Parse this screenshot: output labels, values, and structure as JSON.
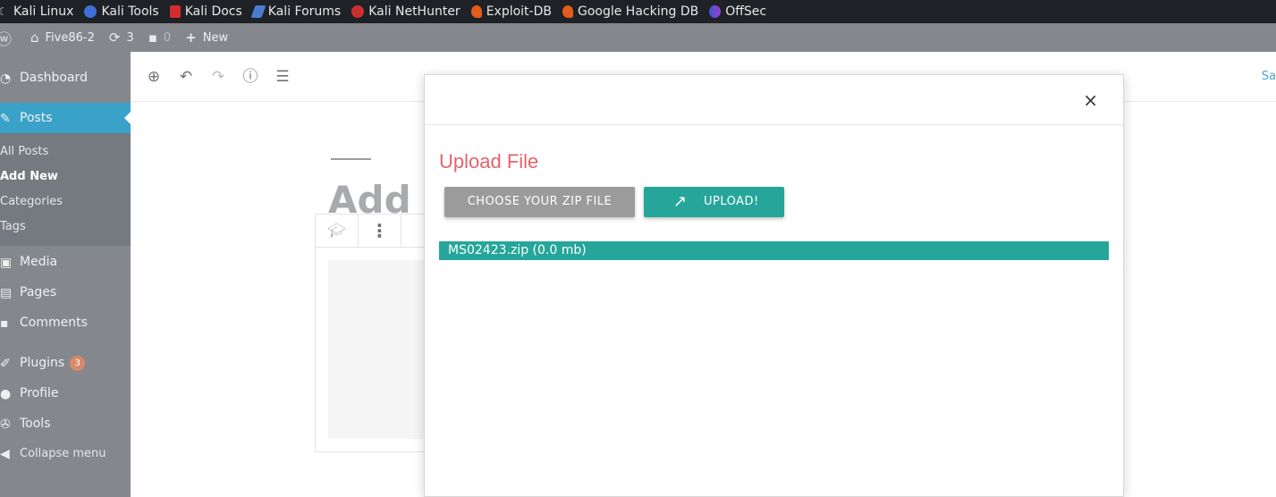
{
  "bookmarks": [
    {
      "label": "Kali Linux",
      "icon": "kali-dragon-icon"
    },
    {
      "label": "Kali Tools",
      "icon": "kali-tools-icon"
    },
    {
      "label": "Kali Docs",
      "icon": "kali-docs-icon"
    },
    {
      "label": "Kali Forums",
      "icon": "kali-forums-icon"
    },
    {
      "label": "Kali NetHunter",
      "icon": "nethunter-icon"
    },
    {
      "label": "Exploit-DB",
      "icon": "exploit-db-icon"
    },
    {
      "label": "Google Hacking DB",
      "icon": "ghdb-icon"
    },
    {
      "label": "OffSec",
      "icon": "offsec-icon"
    }
  ],
  "adminbar": {
    "site_name": "Five86-2",
    "updates_count": "3",
    "comments_count": "0",
    "new_label": "New"
  },
  "sidebar": {
    "items": [
      {
        "label": "Dashboard",
        "icon": "dashboard-icon"
      },
      {
        "label": "Posts",
        "icon": "pin-icon"
      },
      {
        "label": "Media",
        "icon": "media-icon"
      },
      {
        "label": "Pages",
        "icon": "pages-icon"
      },
      {
        "label": "Comments",
        "icon": "comments-icon"
      },
      {
        "label": "Plugins",
        "icon": "plugins-icon",
        "badge": "3"
      },
      {
        "label": "Profile",
        "icon": "profile-icon"
      },
      {
        "label": "Tools",
        "icon": "tools-icon"
      }
    ],
    "submenu": [
      "All Posts",
      "Add New",
      "Categories",
      "Tags"
    ],
    "collapse_label": "Collapse menu"
  },
  "editor": {
    "save_label": "Sa",
    "title_placeholder": "Add t"
  },
  "modal": {
    "title": "Upload File",
    "choose_label": "CHOOSE YOUR ZIP FILE",
    "upload_label": "UPLOAD!",
    "close_glyph": "×",
    "file_entry": "MS02423.zip (0.0 mb)"
  },
  "colors": {
    "accent_teal": "#26a69a",
    "title_red": "#e2636c",
    "sidebar_active": "#3aa2c8"
  }
}
